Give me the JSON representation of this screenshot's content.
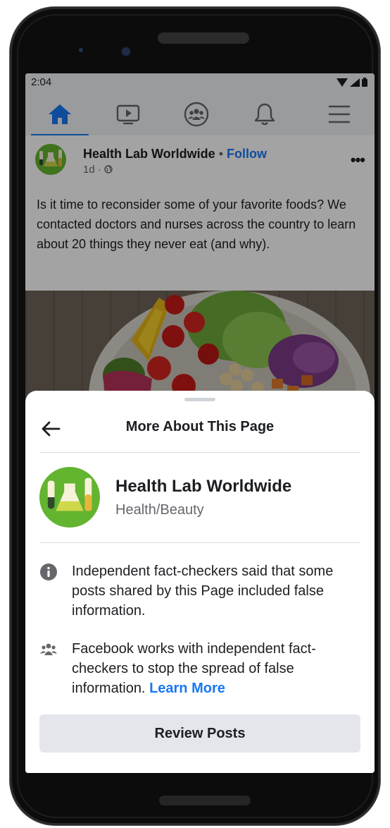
{
  "status_bar": {
    "time": "2:04"
  },
  "nav": {
    "items": [
      {
        "name": "home"
      },
      {
        "name": "watch"
      },
      {
        "name": "groups"
      },
      {
        "name": "notifications"
      },
      {
        "name": "menu"
      }
    ]
  },
  "post": {
    "page_name": "Health Lab Worldwide",
    "separator": "•",
    "follow_label": "Follow",
    "meta": "1d ·",
    "more_label": "•••",
    "text": "Is it time to reconsider some of your favorite foods? We contacted doctors and nurses across the country to learn about 20 things they never eat (and why)."
  },
  "sheet": {
    "title": "More About This Page",
    "page_name": "Health Lab Worldwide",
    "page_category": "Health/Beauty",
    "fact_check_notice": "Independent fact-checkers said that some posts shared by this Page included false information.",
    "partnership_text": "Facebook works with independent fact-checkers to stop the spread of false information.",
    "learn_more_label": "Learn More",
    "review_button_label": "Review Posts"
  },
  "colors": {
    "accent": "#1877f2",
    "avatar_green": "#63b42f",
    "button_bg": "#e4e6eb"
  }
}
